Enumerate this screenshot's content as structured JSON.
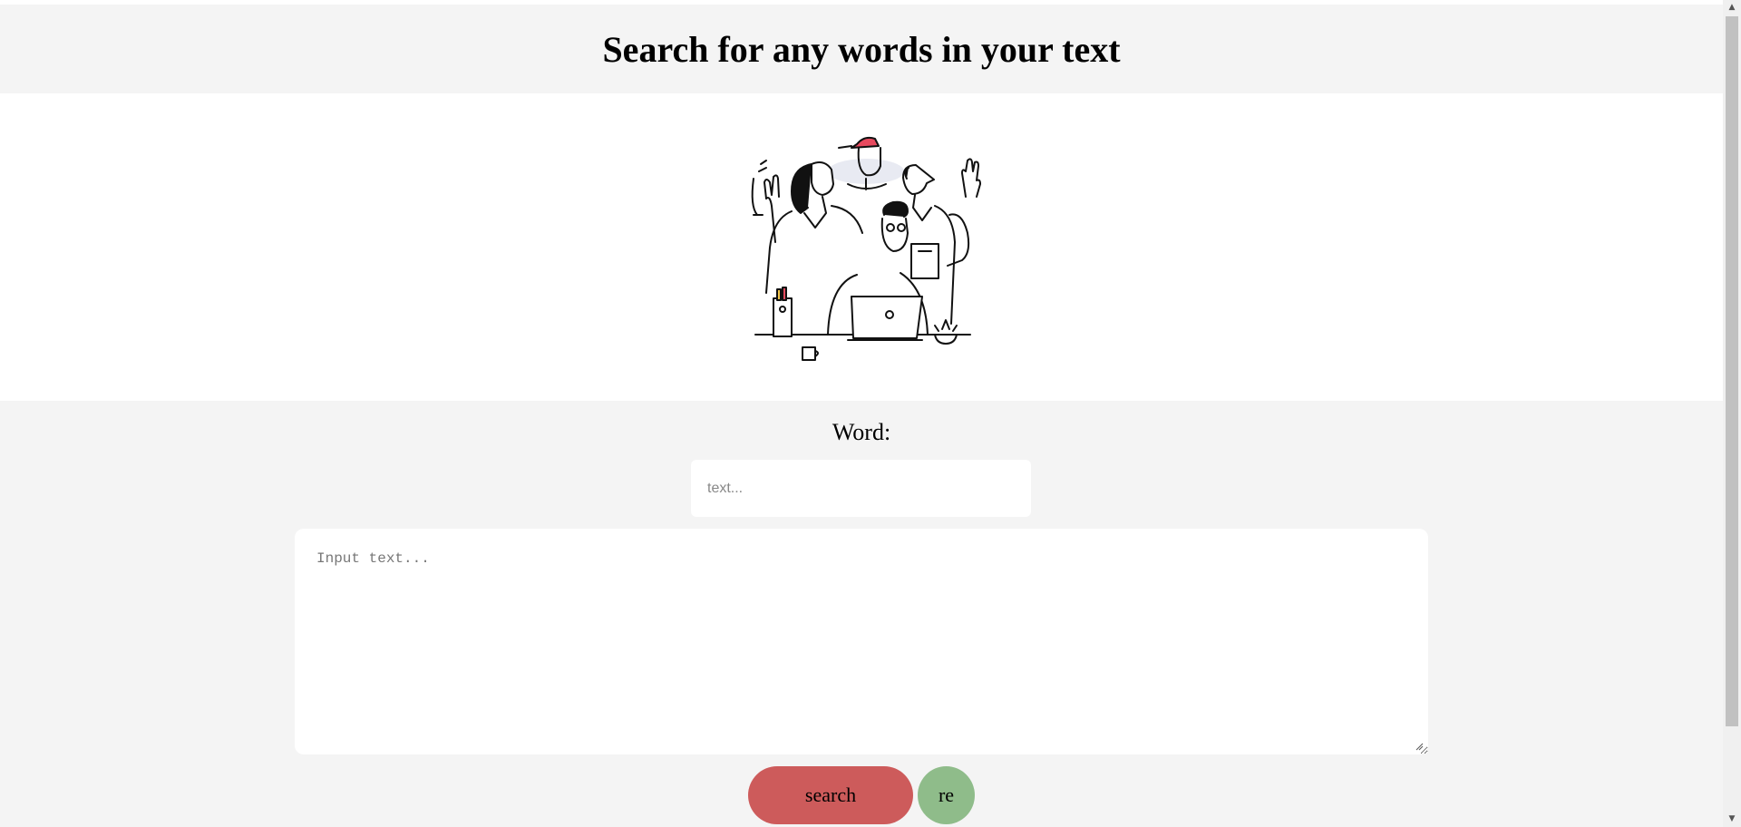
{
  "header": {
    "title": "Search for any words in your text"
  },
  "hero": {
    "illustration": "team-illustration"
  },
  "form": {
    "word_label": "Word:",
    "word_placeholder": "text...",
    "textarea_placeholder": "Input text...",
    "search_label": "search",
    "reset_label": "re"
  },
  "colors": {
    "search_button": "#cd5b5b",
    "reset_button": "#8fbc8a",
    "page_background": "#f4f4f4",
    "hero_background": "#ffffff"
  },
  "scrollbar": {
    "up_icon": "arrow-up-icon",
    "down_icon": "arrow-down-icon"
  }
}
